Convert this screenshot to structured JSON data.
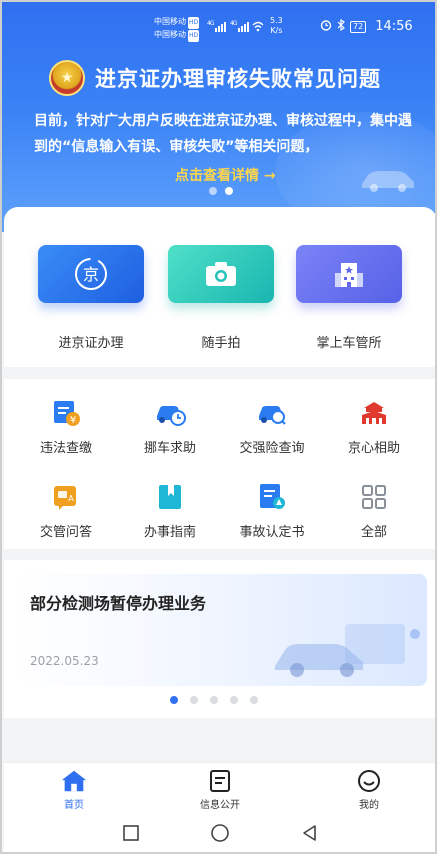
{
  "status_bar": {
    "carrier_1": "中国移动",
    "carrier_2": "中国移动",
    "hd_badge": "HD",
    "signal_1": "⁴ᴳ",
    "signal_2": "⁴ᴳ",
    "net_speed_value": "5.3",
    "net_speed_unit": "K/s",
    "battery": "72",
    "time": "14:56"
  },
  "hero": {
    "title": "进京证办理审核失败常见问题",
    "description": "目前，针对广大用户反映在进京证办理、审核过程中，集中遇到的“信息输入有误、审核失败”等相关问题，",
    "link_text": "点击查看详情 →",
    "page_count": 2,
    "active_page": 2
  },
  "main_services": [
    {
      "label": "进京证办理",
      "icon": "jing-badge-icon"
    },
    {
      "label": "随手拍",
      "icon": "camera-icon"
    },
    {
      "label": "掌上车管所",
      "icon": "building-icon"
    }
  ],
  "grid_services": [
    {
      "label": "违法查缴",
      "icon": "fine-payment-icon"
    },
    {
      "label": "挪车求助",
      "icon": "move-car-icon"
    },
    {
      "label": "交强险查询",
      "icon": "insurance-query-icon"
    },
    {
      "label": "京心相助",
      "icon": "tiananmen-icon"
    },
    {
      "label": "交管问答",
      "icon": "qa-icon"
    },
    {
      "label": "办事指南",
      "icon": "guide-bookmark-icon"
    },
    {
      "label": "事故认定书",
      "icon": "accident-document-icon"
    },
    {
      "label": "全部",
      "icon": "all-grid-icon"
    }
  ],
  "news": {
    "title": "部分检测场暂停办理业务",
    "date": "2022.05.23",
    "page_count": 5,
    "active_page": 1
  },
  "bottom_nav": [
    {
      "label": "首页",
      "icon": "home-icon",
      "active": true
    },
    {
      "label": "信息公开",
      "icon": "info-document-icon",
      "active": false
    },
    {
      "label": "我的",
      "icon": "profile-smile-icon",
      "active": false
    }
  ],
  "colors": {
    "brand_blue": "#2f6ff0",
    "hero_link": "#ffd54a",
    "fine_orange": "#f0a020",
    "grid_blue": "#2a7cf0",
    "red": "#e03a2f"
  }
}
